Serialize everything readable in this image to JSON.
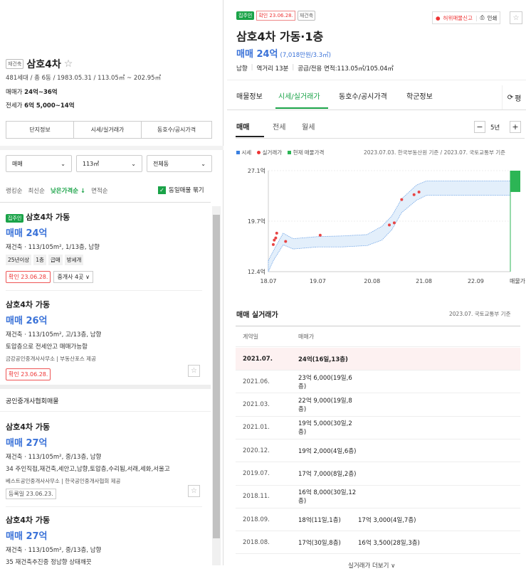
{
  "left": {
    "complex": {
      "type_badge": "재건축",
      "name": "삼호4차",
      "star": "☆",
      "info": "481세대 / 총 6동 / 1983.05.31 / 113.05㎡ ~ 202.95㎡",
      "trade_label": "매매가",
      "trade_value": "24억~36억",
      "jeonse_label": "전세가",
      "jeonse_value": "6억 5,000~14억"
    },
    "tabs": [
      "단지정보",
      "시세/실거래가",
      "동호수/공시가격"
    ],
    "filters": {
      "type": "매매",
      "area": "113㎡",
      "dong": "전체동"
    },
    "sort": [
      "랭킹순",
      "최신순",
      "낮은가격순 ↓",
      "면적순"
    ],
    "same_listing": "동일매물 묶기",
    "listings": [
      {
        "owner_badge": "집주인",
        "title": "삼호4차 가동",
        "price": "매매 24억",
        "desc": "재건축 · 113/105m², 1/13층, 남향",
        "tags": [
          "25년이상",
          "1층",
          "급매",
          "방세개"
        ],
        "confirm": "확인 23.06.28.",
        "agent": "중개사 4곳"
      },
      {
        "title": "삼호4차 가동",
        "price": "매매 26억",
        "desc": "재건축 · 113/105m², 고/13층, 남향",
        "note": "토압층으로 전세안고 매매가능함",
        "agency": "금강공인중개사사무소",
        "provider": "부동산포스 제공",
        "confirm": "확인 23.06.28."
      }
    ],
    "section_header": "공인중개사협회매물",
    "listings2": [
      {
        "title": "삼호4차 가동",
        "price": "매매 27억",
        "desc": "재건축 · 113/105m², 중/13층, 남향",
        "note": "34 주인직접,재건축,세안고,남향,토압층,수리됨,서래,세화,서울고",
        "agency": "베스트공인중개사사무소",
        "provider": "한국공인중개사협회 제공",
        "confirm": "등록일 23.06.23."
      },
      {
        "title": "삼호4차 가동",
        "price": "매매 27억",
        "desc": "재건축 · 113/105m², 중/13층, 남향",
        "note": "35 재건축추진중 정남향 상태깨끗"
      }
    ]
  },
  "right": {
    "owner_badge": "집주인",
    "confirm": "확인 23.06.28.",
    "type_badge": "재건축",
    "report": "허위매물신고",
    "print": "인쇄",
    "title": "삼호4차 가동·1층",
    "price": "매매 24억",
    "price_sub": "(7,018만원/3.3㎡)",
    "facts": [
      "남향",
      "역거리 13분",
      "공급/전용 면적:113.05㎡/105.04㎡"
    ],
    "tabs": [
      "매물정보",
      "시세/실거래가",
      "동호수/공시가격",
      "학군정보"
    ],
    "tab_extra": "평",
    "subtabs": [
      "매매",
      "전세",
      "월세"
    ],
    "period": "5년",
    "legend": [
      "시세",
      "실거래가",
      "현재 매물가격"
    ],
    "source": "2023.07.03. 한국부동산원 기준 / 2023.07. 국토교통부 기준",
    "trades_title": "매매 실거래가",
    "trades_source": "2023.07. 국토교통부 기준",
    "col_date": "계약일",
    "col_price": "매매가",
    "trades": [
      {
        "date": "2021.07.",
        "p1": "24억(16일,13층)",
        "p2": ""
      },
      {
        "date": "2021.06.",
        "p1": "23억 6,000(19일,6층)",
        "p2": ""
      },
      {
        "date": "2021.03.",
        "p1": "22억 9,000(19일,8층)",
        "p2": ""
      },
      {
        "date": "2021.01.",
        "p1": "19억 5,000(30일,2층)",
        "p2": ""
      },
      {
        "date": "2020.12.",
        "p1": "19억 2,000(4일,6층)",
        "p2": ""
      },
      {
        "date": "2019.07.",
        "p1": "17억 7,000(8일,2층)",
        "p2": ""
      },
      {
        "date": "2018.11.",
        "p1": "16억 8,000(30일,12층)",
        "p2": ""
      },
      {
        "date": "2018.09.",
        "p1": "18억(11일,1층)",
        "p2": "17억 3,000(4일,7층)"
      },
      {
        "date": "2018.08.",
        "p1": "17억(30일,8층)",
        "p2": "16억 3,500(28일,3층)"
      }
    ],
    "more": "실거래가 더보기 ∨"
  },
  "chart_data": {
    "type": "line",
    "ylabels": [
      "27.1억",
      "19.7억",
      "12.4억"
    ],
    "xlabels": [
      "18.07",
      "19.07",
      "20.08",
      "21.08",
      "22.09",
      "매물가"
    ],
    "ylim": [
      12.4,
      27.1
    ],
    "series": [
      {
        "name": "시세",
        "band": [
          [
            2018.5,
            12.4,
            14.0
          ],
          [
            2018.6,
            14.0,
            15.4
          ],
          [
            2018.8,
            16.3,
            18.0
          ],
          [
            2019.0,
            15.7,
            17.2
          ],
          [
            2019.5,
            16.0,
            17.5
          ],
          [
            2020.0,
            16.0,
            17.6
          ],
          [
            2020.5,
            16.2,
            17.8
          ],
          [
            2020.8,
            17.0,
            19.0
          ],
          [
            2021.0,
            18.5,
            20.5
          ],
          [
            2021.2,
            21.0,
            23.0
          ],
          [
            2021.5,
            22.8,
            25.0
          ],
          [
            2021.7,
            23.5,
            25.6
          ],
          [
            2022.0,
            23.5,
            25.6
          ],
          [
            2023.0,
            23.5,
            25.6
          ],
          [
            2023.4,
            23.5,
            25.6
          ]
        ]
      },
      {
        "name": "실거래가",
        "points": [
          [
            2018.6,
            16.35
          ],
          [
            2018.62,
            17.0
          ],
          [
            2018.65,
            17.3
          ],
          [
            2018.67,
            18.0
          ],
          [
            2018.85,
            16.8
          ],
          [
            2019.55,
            17.7
          ],
          [
            2020.95,
            19.2
          ],
          [
            2021.05,
            19.5
          ],
          [
            2021.2,
            22.9
          ],
          [
            2021.45,
            23.6
          ],
          [
            2021.55,
            24.0
          ]
        ]
      },
      {
        "name": "현재 매물가격",
        "value": 24
      }
    ]
  }
}
